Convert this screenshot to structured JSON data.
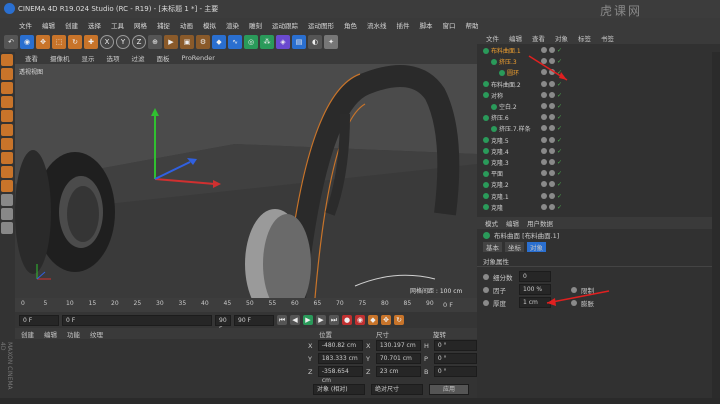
{
  "title": "CINEMA 4D R19.024 Studio (RC - R19) - [未标题 1 *] - 主要",
  "watermark": "虎课网",
  "menu": [
    "文件",
    "编辑",
    "创建",
    "选择",
    "工具",
    "网格",
    "捕捉",
    "动画",
    "模拟",
    "渲染",
    "雕刻",
    "运动跟踪",
    "运动图形",
    "角色",
    "流水线",
    "插件",
    "脚本",
    "窗口",
    "帮助"
  ],
  "toolbar_icons": [
    "undo-icon",
    "move-icon",
    "scale-icon",
    "rotate-icon",
    "x-axis",
    "y-axis",
    "z-axis",
    "coord-icon",
    "render-icon",
    "render-view-icon",
    "render-settings-icon",
    "cube-icon",
    "spline-icon",
    "nurbs-icon",
    "array-icon",
    "deformer-icon",
    "scene-icon",
    "camera-icon",
    "light-icon"
  ],
  "toolbar_letters": [
    "X",
    "Y",
    "Z"
  ],
  "viewport": {
    "menu": [
      "查看",
      "摄像机",
      "显示",
      "选项",
      "过滤",
      "面板",
      "ProRender"
    ],
    "label": "透视视图",
    "grid_text": "网格间距 : 100 cm"
  },
  "timeline": {
    "ticks": [
      "0",
      "5",
      "10",
      "15",
      "20",
      "25",
      "30",
      "35",
      "40",
      "45",
      "50",
      "55",
      "60",
      "65",
      "70",
      "75",
      "80",
      "85",
      "90"
    ],
    "end": "0 F"
  },
  "transport": {
    "start": "0 F",
    "current": "0 F",
    "end": "90 F",
    "max": "90 F"
  },
  "material_menu": [
    "创建",
    "编辑",
    "功能",
    "纹理"
  ],
  "coords": {
    "headers": [
      "位置",
      "尺寸",
      "旋转"
    ],
    "rows": [
      {
        "axis": "X",
        "pos": "-480.82 cm",
        "size": "130.197 cm",
        "rot_label": "H",
        "rot": "0 °"
      },
      {
        "axis": "Y",
        "pos": "183.333 cm",
        "size": "70.701 cm",
        "rot_label": "P",
        "rot": "0 °"
      },
      {
        "axis": "Z",
        "pos": "-358.654 cm",
        "size": "23 cm",
        "rot_label": "B",
        "rot": "0 °"
      }
    ],
    "mode": "对象 (相对)",
    "size_mode": "绝对尺寸",
    "apply": "应用"
  },
  "objects": {
    "tabs": [
      "文件",
      "编辑",
      "查看",
      "对象",
      "标签",
      "书签"
    ],
    "rows": [
      {
        "name": "布料曲面.1",
        "indent": 0,
        "color": "#f0a030"
      },
      {
        "name": "挤压.3",
        "indent": 1,
        "color": "#f0a030"
      },
      {
        "name": "圆环",
        "indent": 2,
        "color": "#f0a030"
      },
      {
        "name": "布料曲面.2",
        "indent": 0,
        "color": "#d0d0d0"
      },
      {
        "name": "对称",
        "indent": 0,
        "color": "#d0d0d0"
      },
      {
        "name": "空白.2",
        "indent": 1,
        "color": "#d0d0d0"
      },
      {
        "name": "挤压.6",
        "indent": 0,
        "color": "#d0d0d0"
      },
      {
        "name": "挤压.7.样条",
        "indent": 1,
        "color": "#d0d0d0"
      },
      {
        "name": "克隆.5",
        "indent": 0,
        "color": "#d0d0d0"
      },
      {
        "name": "克隆.4",
        "indent": 0,
        "color": "#d0d0d0"
      },
      {
        "name": "克隆.3",
        "indent": 0,
        "color": "#d0d0d0"
      },
      {
        "name": "平面",
        "indent": 0,
        "color": "#d0d0d0"
      },
      {
        "name": "克隆.2",
        "indent": 0,
        "color": "#d0d0d0"
      },
      {
        "name": "克隆.1",
        "indent": 0,
        "color": "#d0d0d0"
      },
      {
        "name": "克隆",
        "indent": 0,
        "color": "#d0d0d0"
      }
    ]
  },
  "attributes": {
    "tabs": [
      "模式",
      "编辑",
      "用户数据"
    ],
    "object_name": "布料曲面 [布料曲面.1]",
    "subtabs": [
      "基本",
      "坐标",
      "对象"
    ],
    "section": "对象属性",
    "fields": [
      {
        "label": "细分数",
        "value": "0",
        "extra": ""
      },
      {
        "label": "因子",
        "value": "100 %",
        "extra": "限制"
      },
      {
        "label": "厚度",
        "value": "1 cm",
        "extra": "膨胀"
      }
    ]
  },
  "colors": {
    "accent": "#c8742a",
    "axis_x": "#d03030",
    "axis_y": "#30c030",
    "axis_z": "#3060e0",
    "arrow": "#e02020"
  }
}
